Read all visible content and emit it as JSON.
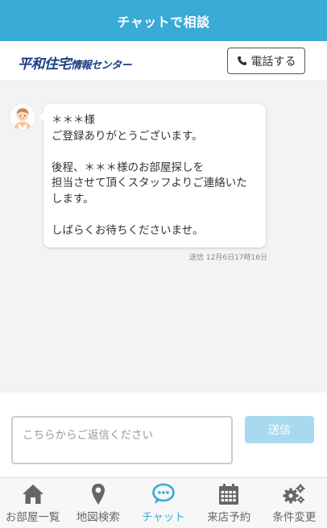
{
  "header": {
    "title": "チャットで相談"
  },
  "brand": {
    "logo_main": "平和住宅",
    "logo_sub": "情報センター",
    "call_label": "電話する"
  },
  "chat": {
    "messages": [
      {
        "sender": "staff",
        "text": "＊＊＊様\nご登録ありがとうございます。\n\n後程、＊＊＊様のお部屋探しを\n担当させて頂くスタッフよりご連絡いた\nします。\n\nしばらくお待ちくださいませ。",
        "timestamp": "送信 12月6日17時16分"
      }
    ]
  },
  "compose": {
    "placeholder": "こちらからご返信ください",
    "value": "",
    "send_label": "送信"
  },
  "tabs": [
    {
      "label": "お部屋一覧",
      "icon": "home-icon",
      "active": false
    },
    {
      "label": "地図検索",
      "icon": "map-pin-icon",
      "active": false
    },
    {
      "label": "チャット",
      "icon": "chat-icon",
      "active": true
    },
    {
      "label": "来店予約",
      "icon": "calendar-icon",
      "active": false
    },
    {
      "label": "条件変更",
      "icon": "gears-icon",
      "active": false
    }
  ],
  "colors": {
    "accent": "#3aaad7",
    "logo": "#1b3f86",
    "send_disabled": "#a9d9ee",
    "tab_inactive": "#666666"
  }
}
